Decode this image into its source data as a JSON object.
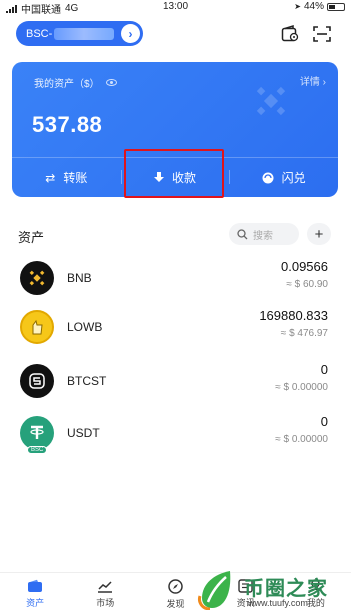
{
  "status_bar": {
    "carrier": "中国联通",
    "network": "4G",
    "time": "13:00",
    "battery": "44%"
  },
  "header": {
    "wallet_name": "BSC-"
  },
  "asset_card": {
    "label": "我的资产（$）",
    "details_link": "详情",
    "total": "537.88",
    "actions": [
      {
        "label": "转账",
        "icon": "transfer-icon"
      },
      {
        "label": "收款",
        "icon": "receive-icon"
      },
      {
        "label": "闪兑",
        "icon": "swap-icon"
      }
    ]
  },
  "assets_section": {
    "title": "资产",
    "search_placeholder": "搜索"
  },
  "assets": [
    {
      "symbol": "BNB",
      "balance": "0.09566",
      "fiat": "≈ $ 60.90"
    },
    {
      "symbol": "LOWB",
      "balance": "169880.833",
      "fiat": "≈ $ 476.97"
    },
    {
      "symbol": "BTCST",
      "balance": "0",
      "fiat": "≈ $ 0.00000"
    },
    {
      "symbol": "USDT",
      "balance": "0",
      "fiat": "≈ $ 0.00000"
    }
  ],
  "usdt_badge": "BSC",
  "bottom_nav": [
    {
      "label": "资产",
      "icon": "wallet-icon",
      "active": true
    },
    {
      "label": "市场",
      "icon": "chart-icon",
      "active": false
    },
    {
      "label": "发现",
      "icon": "compass-icon",
      "active": false
    },
    {
      "label": "资讯",
      "icon": "news-icon",
      "active": false
    },
    {
      "label": "我的",
      "icon": "profile-icon",
      "active": false
    }
  ],
  "watermark": {
    "brand": "币圈之家",
    "url": "www.tuufy.com"
  },
  "colors": {
    "accent": "#2f6df2",
    "highlight": "#e0141b",
    "bnb": "#f3ba2f",
    "usdt": "#26a17b"
  }
}
